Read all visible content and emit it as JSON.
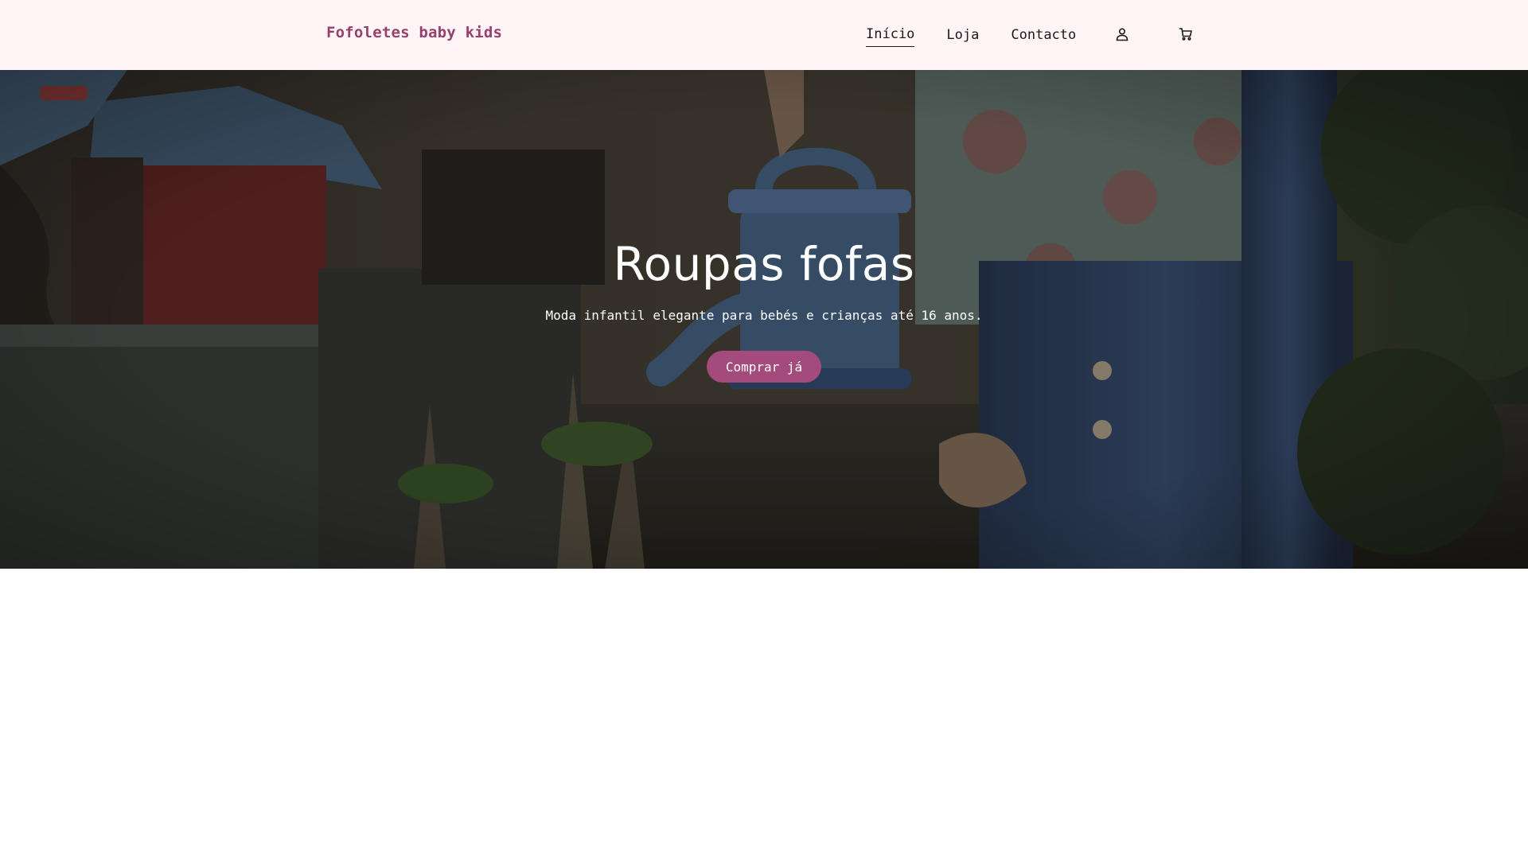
{
  "brand": {
    "name": "Fofoletes baby kids",
    "color": "#96406c"
  },
  "nav": {
    "items": [
      {
        "label": "Início",
        "active": true
      },
      {
        "label": "Loja",
        "active": false
      },
      {
        "label": "Contacto",
        "active": false
      }
    ],
    "account_icon": "user-icon",
    "cart_icon": "cart-icon"
  },
  "hero": {
    "title": "Roupas fofas",
    "subtitle": "Moda infantil elegante para bebés e crianças até 16 anos.",
    "cta_label": "Comprar já",
    "cta_color": "#a24b7c",
    "background_description_icon": "hero-photo"
  },
  "colors": {
    "header_bg": "#fff5f7",
    "page_bg": "#ffffff"
  }
}
